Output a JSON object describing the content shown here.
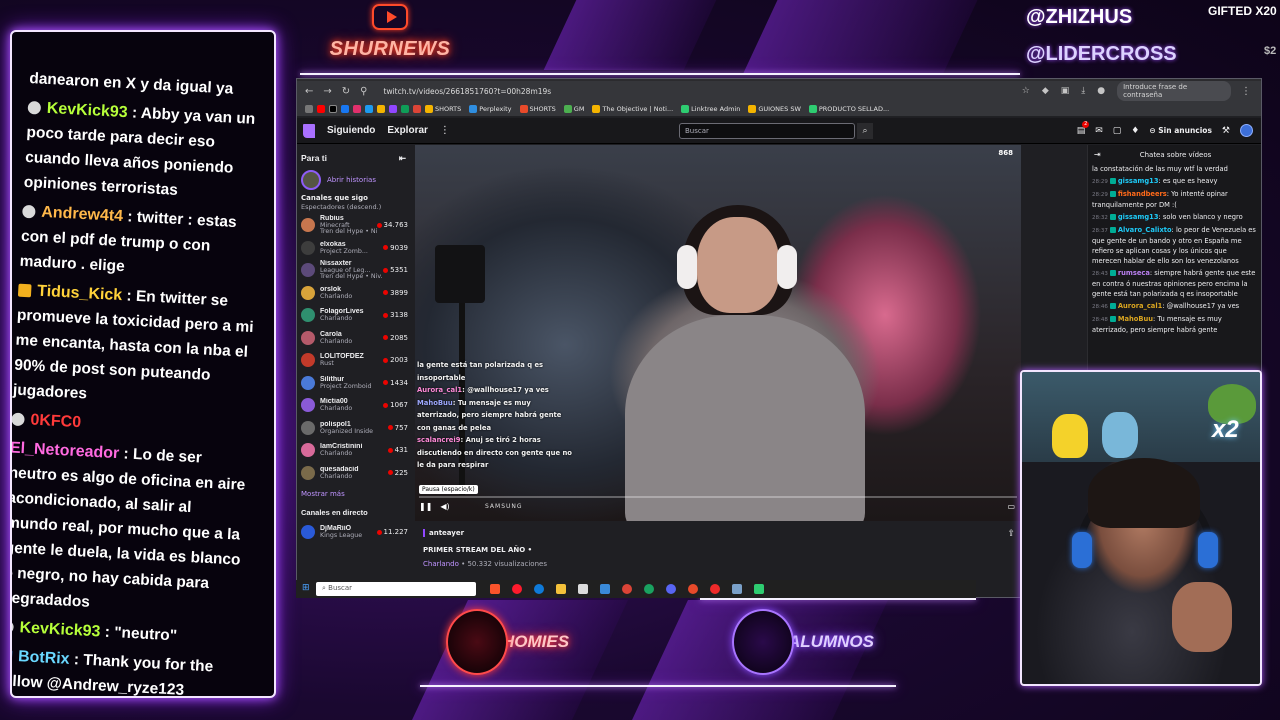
{
  "overlay": {
    "logo_text": "SHURNEWS",
    "gift_label": "GIFTED X20",
    "gift_user1": "@ZHIZHUS",
    "gift_user2": "@LIDERCROSS",
    "gift_count": "$2",
    "homies_label": "HOMIES",
    "alumnos_label": "ALUMNOS",
    "webcam_badge": "x2"
  },
  "stream_chat": {
    "messages": [
      {
        "user": "",
        "text": "danearon en X y da igual ya",
        "badge": "none",
        "color": "#ffffff"
      },
      {
        "user": "KevKick93",
        "text": "Abby ya van un poco tarde para decir eso cuando lleva años poniendo opiniones terroristas",
        "badge": "gray",
        "color": "#b6ff3a"
      },
      {
        "user": "Andrew4t4",
        "text": "twitter : estas con el pdf de trump o con maduro . elige",
        "badge": "gray",
        "color": "#ffb84a"
      },
      {
        "user": "Tidus_Kick",
        "text": "En twitter se promueve la toxicidad pero a mi me encanta, hasta con la nba el 90% de post son puteando jugadores",
        "badge": "crown",
        "color": "#ffd23a"
      },
      {
        "user": "0KFC0",
        "text": "",
        "badge": "gray",
        "color": "#ff3a3a"
      },
      {
        "user": "El_Netoreador",
        "text": "Lo de ser neutro es algo de oficina en aire acondicionado, al salir al mundo real, por mucho que a la gente le duela, la vida es blanco o negro, no hay cabida para degradados",
        "badge": "none",
        "color": "#ff6ae0"
      },
      {
        "user": "KevKick93",
        "text": "\"neutro\"",
        "badge": "gray",
        "color": "#b6ff3a"
      },
      {
        "user": "BotRix",
        "text": "Thank you for the follow @Andrew_ryze123",
        "badge": "blue",
        "color": "#6ad8ff"
      }
    ]
  },
  "browser": {
    "url": "twitch.tv/videos/2661851760?t=00h28m19s",
    "password_pill": "Introduce frase de contraseña",
    "bookmarks": [
      "SHORTS",
      "Perplexity",
      "SHORTS",
      "GM",
      "The Objective | Noti...",
      "Linktree Admin",
      "GUIONES SW",
      "PRODUCTO SELLAD..."
    ]
  },
  "twitch_nav": {
    "following": "Siguiendo",
    "browse": "Explorar",
    "search_placeholder": "Buscar",
    "no_ads": "Sin anuncios"
  },
  "sidebar": {
    "for_you": "Para ti",
    "open_stories": "Abrir historias",
    "followed_title": "Canales que sigo",
    "followed_sort": "Espectadores (descend.)",
    "channels": [
      {
        "name": "Rubius",
        "game": "Minecraft",
        "extra": "Tren del Hype • Niv...",
        "viewers": "34.763",
        "color": "#c7764e"
      },
      {
        "name": "elxokas",
        "game": "Project Zomb...",
        "viewers": "9039",
        "color": "#3d3d3d"
      },
      {
        "name": "Nissaxter",
        "game": "League of Leg...",
        "extra": "Tren del Hype • Niv...",
        "viewers": "5351",
        "color": "#5c4a7a"
      },
      {
        "name": "orslok",
        "game": "Charlando",
        "viewers": "3899",
        "color": "#d8a33a"
      },
      {
        "name": "FolagorLives",
        "game": "Charlando",
        "viewers": "3138",
        "color": "#2f8f6f"
      },
      {
        "name": "Carola",
        "game": "Charlando",
        "viewers": "2085",
        "color": "#b55a6a"
      },
      {
        "name": "LOLITOFDEZ",
        "game": "Rust",
        "viewers": "2003",
        "color": "#c23a2a"
      },
      {
        "name": "Silithur",
        "game": "Project Zomboid",
        "viewers": "1434",
        "color": "#4a7ad8"
      },
      {
        "name": "Mictia00",
        "game": "Charlando",
        "viewers": "1067",
        "color": "#8a5ad8"
      },
      {
        "name": "polispol1",
        "game": "Organized Inside",
        "viewers": "757",
        "color": "#6a6a6a"
      },
      {
        "name": "IamCristinini",
        "game": "Charlando",
        "viewers": "431",
        "color": "#d86a9a"
      },
      {
        "name": "quesadacid",
        "game": "Charlando",
        "viewers": "225",
        "color": "#7a6a4a"
      }
    ],
    "show_more": "Mostrar más",
    "live_title": "Canales en directo",
    "live_channels": [
      {
        "name": "DjMaRiiO",
        "game": "Kings League",
        "viewers": "11.227",
        "color": "#2a5ad8"
      }
    ]
  },
  "video": {
    "viewers_badge": "868",
    "tooltip": "Pausa (espacio/k)",
    "brand": "SAMSUNG",
    "progress": 0.0,
    "chat_overlay": [
      {
        "user": "",
        "text": "la gente está tan polarizada q es insoportable"
      },
      {
        "user": "Aurora_cal1",
        "text": "@wallhouse17 ya ves"
      },
      {
        "user": "MahoBuu",
        "text": "Tu mensaje es muy aterrizado, pero siempre habrá gente con ganas de pelea"
      },
      {
        "user": "scalancrei9",
        "text": "Anuj se tiró 2 horas discutiendo en directo con gente que no le da para respirar"
      }
    ]
  },
  "stream_info": {
    "channel": "anteayer",
    "title": "PRIMER STREAM DEL AÑO •",
    "category": "Charlando",
    "views": "• 50.332 visualizaciones"
  },
  "twitch_chat": {
    "header": "Chatea sobre vídeos",
    "messages": [
      {
        "time": "",
        "user": "",
        "text": "la constatación de las muy wtf la verdad",
        "ucolor": "#efeff1"
      },
      {
        "time": "28:29",
        "user": "gissamg13",
        "text": "es que es heavy",
        "ucolor": "#1ecaf7"
      },
      {
        "time": "28:29",
        "user": "fishandbeers",
        "text": "Yo intenté opinar tranquilamente por DM :(",
        "ucolor": "#ff6a1a"
      },
      {
        "time": "28:32",
        "user": "gissamg13",
        "text": "solo ven blanco y negro",
        "ucolor": "#1ecaf7"
      },
      {
        "time": "28:37",
        "user": "Alvaro_Calixto",
        "text": "lo peor de Venezuela es que gente de un bando y otro en España me refiero se aplican cosas y los únicos que merecen hablar de ello son los venezolanos",
        "ucolor": "#1ecaf7"
      },
      {
        "time": "28:43",
        "user": "rumseca",
        "text": "siempre habrá gente que este en contra ó nuestras opiniones pero encima la gente está tan polarizada q es insoportable",
        "ucolor": "#b97ff0"
      },
      {
        "time": "28:46",
        "user": "Aurora_cal1",
        "text": "@wallhouse17 ya ves",
        "ucolor": "#daa520"
      },
      {
        "time": "28:48",
        "user": "MahoBuu",
        "text": "Tu mensaje es muy aterrizado, pero siempre habrá gente",
        "ucolor": "#daa520"
      }
    ]
  },
  "taskbar": {
    "search": "Buscar"
  }
}
